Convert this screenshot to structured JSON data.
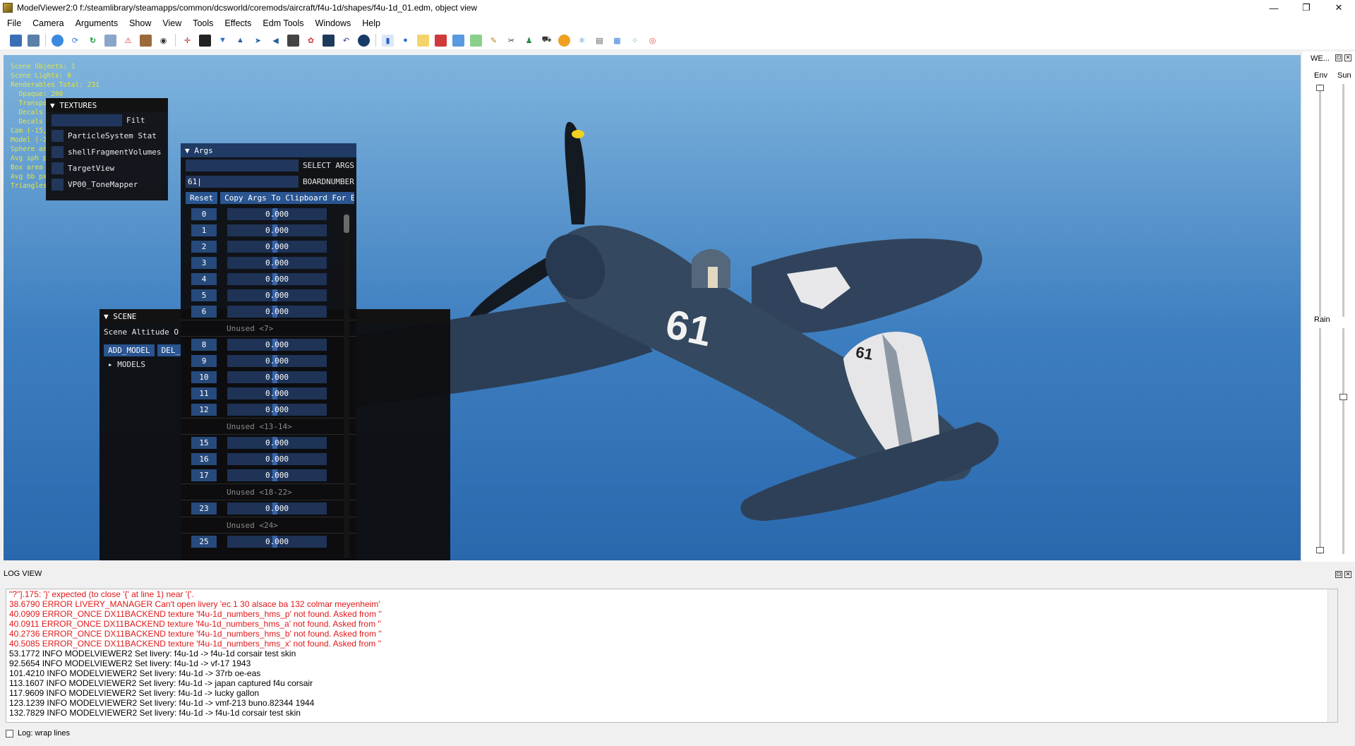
{
  "window": {
    "title": "ModelViewer2:0 f:/steamlibrary/steamapps/common/dcsworld/coremods/aircraft/f4u-1d/shapes/f4u-1d_01.edm, object view",
    "minimize": "—",
    "maximize": "❐",
    "close": "✕"
  },
  "menu": [
    "File",
    "Camera",
    "Arguments",
    "Show",
    "View",
    "Tools",
    "Effects",
    "Edm Tools",
    "Windows",
    "Help"
  ],
  "toolbar_icons": [
    "save-icon",
    "export-icon",
    "sphere-icon",
    "refresh-icon",
    "reload-icon",
    "image-icon",
    "pdf-icon",
    "box-icon",
    "camera-icon",
    "crosshair-icon",
    "grid-icon",
    "light-icon",
    "cone-icon",
    "arrow-icon",
    "speaker-icon",
    "film-icon",
    "palette-icon",
    "monitor-icon",
    "undo-icon",
    "record-icon",
    "chart-icon",
    "cube-blue-icon",
    "folder-icon",
    "cube-red-icon",
    "box-blue-icon",
    "box-green-icon",
    "pencil-icon",
    "tool-icon",
    "person-icon",
    "car-icon",
    "sun-icon",
    "atom-icon",
    "page-icon",
    "table-icon",
    "dots-icon",
    "target-icon"
  ],
  "stats": [
    "Scene Objects: 1",
    "Scene Lights: 0",
    "Renderables Total: 231",
    "  Opaque: 200",
    "  Transpa",
    "  Decals F",
    "  Decals D",
    "Cam (-15,",
    "Model (-2,",
    "Sphere are",
    "Avg sph px",
    "Box area 3",
    "Avg bb px:",
    "Triangles"
  ],
  "textures": {
    "title": "TEXTURES",
    "filter_label": "Filt",
    "items": [
      "ParticleSystem Stat",
      "shellFragmentVolumes",
      "TargetView",
      "VP00_ToneMapper"
    ]
  },
  "args": {
    "title": "Args",
    "select_label": "SELECT ARGS",
    "boardnumber_label": "BOARDNUMBER",
    "boardnumber_value": "61|",
    "reset": "Reset",
    "copy": "Copy Args To Clipboard For E",
    "rows": [
      {
        "idx": "0",
        "val": "0.000"
      },
      {
        "idx": "1",
        "val": "0.000"
      },
      {
        "idx": "2",
        "val": "0.000"
      },
      {
        "idx": "3",
        "val": "0.000"
      },
      {
        "idx": "4",
        "val": "0.000"
      },
      {
        "idx": "5",
        "val": "0.000"
      },
      {
        "idx": "6",
        "val": "0.000"
      },
      {
        "unused": "Unused <7>"
      },
      {
        "idx": "8",
        "val": "0.000"
      },
      {
        "idx": "9",
        "val": "0.000"
      },
      {
        "idx": "10",
        "val": "0.000"
      },
      {
        "idx": "11",
        "val": "0.000"
      },
      {
        "idx": "12",
        "val": "0.000"
      },
      {
        "unused": "Unused <13-14>"
      },
      {
        "idx": "15",
        "val": "0.000"
      },
      {
        "idx": "16",
        "val": "0.000"
      },
      {
        "idx": "17",
        "val": "0.000"
      },
      {
        "unused": "Unused <18-22>"
      },
      {
        "idx": "23",
        "val": "0.000"
      },
      {
        "unused": "Unused <24>"
      },
      {
        "idx": "25",
        "val": "0.000"
      }
    ]
  },
  "scene": {
    "title": "SCENE",
    "altitude_label": "Scene Altitude O",
    "add_model": "ADD_MODEL",
    "del_model": "DEL_",
    "models": "MODELS"
  },
  "weather": {
    "title": "WE...",
    "env": "Env",
    "sun": "Sun",
    "rain": "Rain"
  },
  "aircraft": {
    "board_number": "61",
    "tail_number": "61"
  },
  "log": {
    "title": "LOG VIEW",
    "wrap_label": "Log: wrap lines",
    "lines": [
      {
        "type": "err",
        "text": "\"?\"].175: '}' expected (to close '{' at line 1) near '{'."
      },
      {
        "type": "err",
        "text": "38.6790 ERROR LIVERY_MANAGER Can't open livery 'ec 1 30 alsace ba 132 colmar meyenheim'"
      },
      {
        "type": "err",
        "text": "40.0909 ERROR_ONCE DX11BACKEND texture 'f4u-1d_numbers_hms_p' not found. Asked from ''"
      },
      {
        "type": "err",
        "text": "40.0911 ERROR_ONCE DX11BACKEND texture 'f4u-1d_numbers_hms_a' not found. Asked from ''"
      },
      {
        "type": "err",
        "text": "40.2736 ERROR_ONCE DX11BACKEND texture 'f4u-1d_numbers_hms_b' not found. Asked from ''"
      },
      {
        "type": "err",
        "text": "40.5085 ERROR_ONCE DX11BACKEND texture 'f4u-1d_numbers_hms_x' not found. Asked from ''"
      },
      {
        "type": "info",
        "text": "53.1772 INFO MODELVIEWER2 Set livery: f4u-1d -> f4u-1d corsair test skin"
      },
      {
        "type": "info",
        "text": "92.5654 INFO MODELVIEWER2 Set livery: f4u-1d -> vf-17 1943"
      },
      {
        "type": "info",
        "text": "101.4210 INFO MODELVIEWER2 Set livery: f4u-1d -> 37rb oe-eas"
      },
      {
        "type": "info",
        "text": "113.1607 INFO MODELVIEWER2 Set livery: f4u-1d -> japan captured f4u corsair"
      },
      {
        "type": "info",
        "text": "117.9609 INFO MODELVIEWER2 Set livery: f4u-1d -> lucky gallon"
      },
      {
        "type": "info",
        "text": "123.1239 INFO MODELVIEWER2 Set livery: f4u-1d -> vmf-213 buno.82344 1944"
      },
      {
        "type": "info",
        "text": "132.7829 INFO MODELVIEWER2 Set livery: f4u-1d -> f4u-1d corsair test skin"
      }
    ]
  }
}
